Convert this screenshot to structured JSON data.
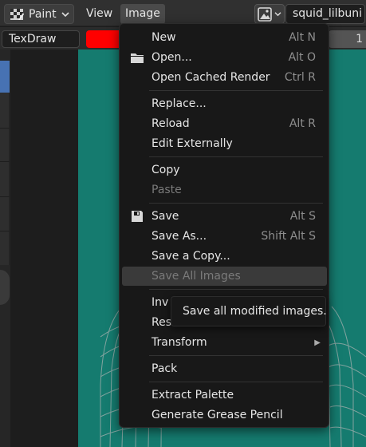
{
  "header": {
    "mode_label": "Paint",
    "menus": {
      "view": "View",
      "image": "Image"
    },
    "image_name": "squid_lilbuni"
  },
  "toolbar": {
    "brush_name": "TexDraw",
    "brush_color": "#ff0000",
    "radius_partial": "1"
  },
  "menu": {
    "new": {
      "label": "New",
      "shortcut": "Alt N"
    },
    "open": {
      "label": "Open...",
      "shortcut": "Alt O"
    },
    "open_cached": {
      "label": "Open Cached Render",
      "shortcut": "Ctrl R"
    },
    "replace": {
      "label": "Replace..."
    },
    "reload": {
      "label": "Reload",
      "shortcut": "Alt R"
    },
    "edit_externally": {
      "label": "Edit Externally"
    },
    "copy": {
      "label": "Copy"
    },
    "paste": {
      "label": "Paste"
    },
    "save": {
      "label": "Save",
      "shortcut": "Alt S"
    },
    "save_as": {
      "label": "Save As...",
      "shortcut": "Shift Alt S"
    },
    "save_copy": {
      "label": "Save a Copy..."
    },
    "save_all": {
      "label": "Save All Images"
    },
    "invert": {
      "label": "Inv"
    },
    "resize": {
      "label": "Res"
    },
    "transform": {
      "label": "Transform"
    },
    "pack": {
      "label": "Pack"
    },
    "extract_palette": {
      "label": "Extract Palette"
    },
    "grease_pencil": {
      "label": "Generate Grease Pencil"
    }
  },
  "tooltip": {
    "text": "Save all modified images."
  },
  "colors": {
    "canvas": "#157b6f",
    "accent": "#4772b3",
    "menu_bg": "#181818",
    "hover": "#3a3a3a"
  }
}
